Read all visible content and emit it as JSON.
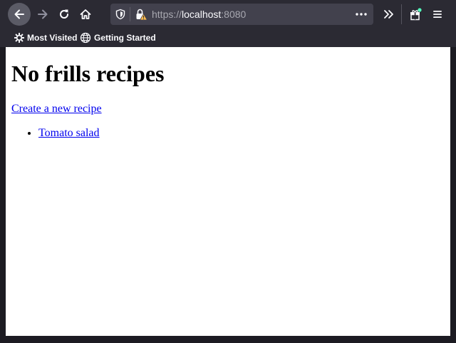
{
  "toolbar": {
    "back_icon": "arrow-left-icon",
    "forward_icon": "arrow-right-icon",
    "reload_icon": "reload-icon",
    "home_icon": "home-icon",
    "url_scheme": "https://",
    "url_host": "localhost",
    "url_port": ":8080",
    "tracking_icon": "shield-icon",
    "security_icon": "insecure-lock-warning-icon",
    "page_actions_icon": "ellipsis-icon",
    "overflow_icon": "double-chevron-icon",
    "extensions_icon": "gift-icon",
    "menu_icon": "hamburger-menu-icon"
  },
  "bookmarks": [
    {
      "label": "Most Visited",
      "icon": "gear-icon"
    },
    {
      "label": "Getting Started",
      "icon": "globe-icon"
    }
  ],
  "page": {
    "heading": "No frills recipes",
    "create_link": "Create a new recipe",
    "recipes": [
      "Tomato salad"
    ]
  },
  "colors": {
    "chrome_bg": "#2b2a33",
    "urlbar_bg": "#42414d",
    "link": "#0000ee",
    "notification_dot": "#54ffbd"
  }
}
